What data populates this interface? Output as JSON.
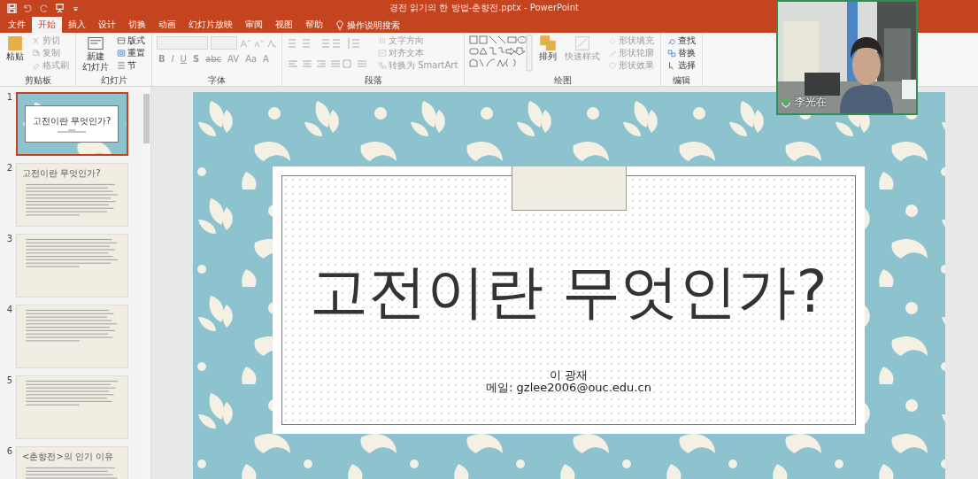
{
  "window": {
    "title": "경전 읽기의 한 방법-춘향전.pptx  -  PowerPoint"
  },
  "tabs": [
    {
      "label": "文件",
      "selected": false
    },
    {
      "label": "开始",
      "selected": true
    },
    {
      "label": "插入",
      "selected": false
    },
    {
      "label": "设计",
      "selected": false
    },
    {
      "label": "切换",
      "selected": false
    },
    {
      "label": "动画",
      "selected": false
    },
    {
      "label": "幻灯片放映",
      "selected": false
    },
    {
      "label": "审阅",
      "selected": false
    },
    {
      "label": "视图",
      "selected": false
    },
    {
      "label": "帮助",
      "selected": false
    }
  ],
  "tell_me": {
    "placeholder": "操作说明搜索"
  },
  "ribbon_groups": [
    {
      "label": "剪贴板",
      "kind": "clipboard",
      "big_buttons": [
        {
          "label_lines": [
            "粘贴"
          ],
          "disabled": false
        }
      ],
      "small_buttons": [
        {
          "label": "剪切",
          "disabled": true
        },
        {
          "label": "复制",
          "disabled": true
        },
        {
          "label": "格式刷",
          "disabled": true
        }
      ]
    },
    {
      "label": "幻灯片",
      "kind": "slides",
      "big_buttons": [
        {
          "label_lines": [
            "新建",
            "幻灯片"
          ],
          "disabled": false
        }
      ],
      "small_buttons": [
        {
          "label": "版式",
          "disabled": false
        },
        {
          "label": "重置",
          "disabled": false
        },
        {
          "label": "节",
          "disabled": false
        }
      ]
    },
    {
      "label": "字体",
      "kind": "font",
      "format_buttons": [
        "B",
        "I",
        "U",
        "S",
        "abc",
        "AV",
        "Aa",
        "A"
      ]
    },
    {
      "label": "段落",
      "kind": "paragraph",
      "small_buttons": [
        {
          "label": "文字方向",
          "disabled": true
        },
        {
          "label": "对齐文本",
          "disabled": true
        },
        {
          "label": "转换为 SmartArt",
          "disabled": true
        }
      ]
    },
    {
      "label": "绘图",
      "kind": "drawing",
      "big_buttons": [
        {
          "label_lines": [
            "排列"
          ],
          "disabled": false
        },
        {
          "label_lines": [
            "快速样式"
          ],
          "disabled": true
        }
      ],
      "small_buttons": [
        {
          "label": "形状填充",
          "disabled": true
        },
        {
          "label": "形状轮廓",
          "disabled": true
        },
        {
          "label": "形状效果",
          "disabled": true
        }
      ]
    },
    {
      "label": "编辑",
      "kind": "editing",
      "small_buttons": [
        {
          "label": "查找",
          "disabled": false
        },
        {
          "label": "替换",
          "disabled": false
        },
        {
          "label": "选择",
          "disabled": false
        }
      ]
    }
  ],
  "slides": [
    {
      "number": "1",
      "kind": "title",
      "selected": true,
      "title": "고전이란 무엇인가?"
    },
    {
      "number": "2",
      "kind": "text",
      "selected": false,
      "title": "고전이란 무엇인가?"
    },
    {
      "number": "3",
      "kind": "text",
      "selected": false
    },
    {
      "number": "4",
      "kind": "text",
      "selected": false
    },
    {
      "number": "5",
      "kind": "text",
      "selected": false
    },
    {
      "number": "6",
      "kind": "text",
      "selected": false,
      "title": "<춘향전>의 인기 이유"
    }
  ],
  "current_slide": {
    "title": "고전이란 무엇인가?",
    "author": "이 광재",
    "email": "메일: gzlee2006@ouc.edu.cn"
  },
  "video": {
    "name": "李光在",
    "mic_on": true
  }
}
